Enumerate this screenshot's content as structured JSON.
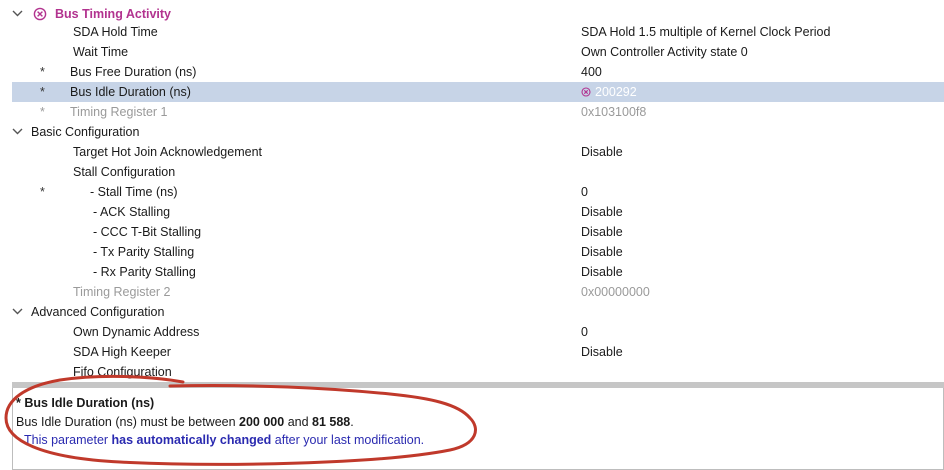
{
  "tree": {
    "bus_timing": {
      "title": "Bus Timing Activity",
      "rows": [
        {
          "label": "SDA Hold Time",
          "value": "SDA Hold 1.5 multiple of Kernel Clock Period",
          "asterisk": ""
        },
        {
          "label": "Wait Time",
          "value": "Own Controller Activity state 0",
          "asterisk": ""
        },
        {
          "label": "Bus Free Duration (ns)",
          "value": "400",
          "asterisk": "*"
        },
        {
          "label": "Bus Idle Duration (ns)",
          "value": "200292",
          "asterisk": "*"
        },
        {
          "label": "Timing Register 1",
          "value": "0x103100f8",
          "asterisk": "*"
        }
      ]
    },
    "basic": {
      "title": "Basic Configuration",
      "rows": [
        {
          "label": "Target Hot Join Acknowledgement",
          "value": "Disable",
          "asterisk": ""
        },
        {
          "label": "Stall Configuration",
          "value": "",
          "asterisk": ""
        },
        {
          "label": "- Stall Time (ns)",
          "value": "0",
          "asterisk": "*"
        },
        {
          "label": "- ACK Stalling",
          "value": "Disable",
          "asterisk": ""
        },
        {
          "label": "- CCC T-Bit Stalling",
          "value": "Disable",
          "asterisk": ""
        },
        {
          "label": "- Tx Parity Stalling",
          "value": "Disable",
          "asterisk": ""
        },
        {
          "label": "- Rx Parity Stalling",
          "value": "Disable",
          "asterisk": ""
        },
        {
          "label": "Timing Register 2",
          "value": "0x00000000",
          "asterisk": ""
        }
      ]
    },
    "advanced": {
      "title": "Advanced Configuration",
      "rows": [
        {
          "label": "Own Dynamic Address",
          "value": "0",
          "asterisk": ""
        },
        {
          "label": "SDA High Keeper",
          "value": "Disable",
          "asterisk": ""
        },
        {
          "label": "Fifo Configuration",
          "value": "",
          "asterisk": ""
        }
      ]
    }
  },
  "description": {
    "title": "* Bus Idle Duration (ns)",
    "line_prefix": "Bus Idle Duration (ns) must be between ",
    "min": "200 000",
    "line_and": " and ",
    "max": "81 588",
    "line_suffix": ".",
    "note_prefix": "This parameter ",
    "note_bold": "has automatically changed",
    "note_suffix": " after your last modification."
  },
  "colors": {
    "error_title": "#b2338f",
    "selection": "#c7d4e7",
    "note": "#2a2ab0",
    "annotation": "#c0392b"
  }
}
